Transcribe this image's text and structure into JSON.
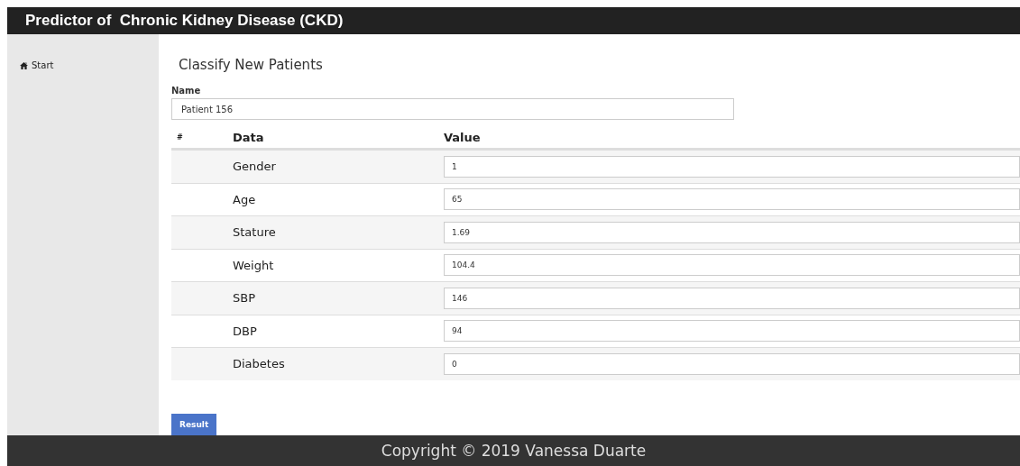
{
  "header": {
    "title": "Predictor of  Chronic Kidney Disease (CKD)"
  },
  "sidebar": {
    "items": [
      {
        "label": "Start"
      }
    ]
  },
  "form": {
    "heading": "Classify New Patients",
    "name_label": "Name",
    "name_value": "Patient 156"
  },
  "table": {
    "columns": [
      "#",
      "Data",
      "Value"
    ],
    "rows": [
      {
        "data": "Gender",
        "value": "1"
      },
      {
        "data": "Age",
        "value": "65"
      },
      {
        "data": "Stature",
        "value": "1.69"
      },
      {
        "data": "Weight",
        "value": "104.4"
      },
      {
        "data": "SBP",
        "value": "146"
      },
      {
        "data": "DBP",
        "value": "94"
      },
      {
        "data": "Diabetes",
        "value": "0"
      }
    ]
  },
  "buttons": [
    "Result"
  ],
  "footer": {
    "text": "Copyright © 2019 Vanessa Duarte"
  }
}
